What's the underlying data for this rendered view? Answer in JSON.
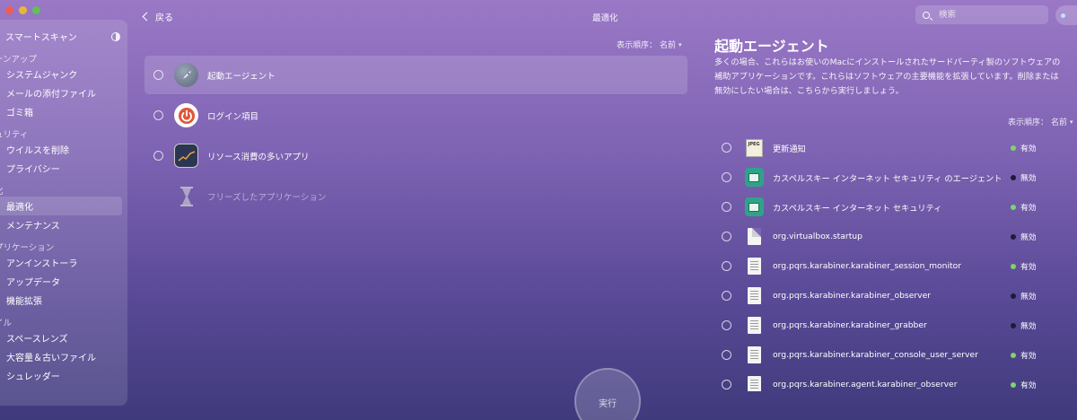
{
  "topbar": {
    "back_label": "戻る",
    "title": "最適化",
    "search_placeholder": "検索"
  },
  "sidebar": {
    "scan_label": "スマートスキャン",
    "sections": [
      {
        "label": "ーンアップ"
      },
      {
        "label": "ュリティ"
      },
      {
        "label": "化"
      },
      {
        "label": "プリケーション"
      },
      {
        "label": "イル"
      }
    ],
    "items": [
      {
        "label": "システムジャンク"
      },
      {
        "label": "メールの添付ファイル"
      },
      {
        "label": "ゴミ箱"
      },
      {
        "label": "ウイルスを削除"
      },
      {
        "label": "プライバシー"
      },
      {
        "label": "最適化"
      },
      {
        "label": "メンテナンス"
      },
      {
        "label": "アンインストーラ"
      },
      {
        "label": "アップデータ"
      },
      {
        "label": "機能拡張"
      },
      {
        "label": "スペースレンズ"
      },
      {
        "label": "大容量＆古いファイル"
      },
      {
        "label": "シュレッダー"
      }
    ]
  },
  "middle": {
    "sort_label": "表示順序：",
    "sort_value": "名前",
    "items": [
      {
        "label": "起動エージェント",
        "icon": "rocket-icon"
      },
      {
        "label": "ログイン項目",
        "icon": "power-icon"
      },
      {
        "label": "リソース消費の多いアプリ",
        "icon": "activity-chart-icon"
      },
      {
        "label": "フリーズしたアプリケーション",
        "icon": "hourglass-icon"
      }
    ]
  },
  "detail": {
    "title": "起動エージェント",
    "description": "多くの場合、これらはお使いのMacにインストールされたサードパーティ製のソフトウェアの補助アプリケーションです。これらはソフトウェアの主要機能を拡張しています。削除または無効にしたい場合は、こちらから実行しましょう。",
    "sort_label": "表示順序：",
    "sort_value": "名前",
    "agents": [
      {
        "name": "更新通知",
        "status": "有効",
        "enabled": true,
        "icon": "jpg-file-icon"
      },
      {
        "name": "カスペルスキー インターネット セキュリティ のエージェント",
        "status": "無効",
        "enabled": false,
        "icon": "kaspersky-icon"
      },
      {
        "name": "カスペルスキー インターネット セキュリティ",
        "status": "有効",
        "enabled": true,
        "icon": "kaspersky-icon"
      },
      {
        "name": "org.virtualbox.startup",
        "status": "無効",
        "enabled": false,
        "icon": "blank-file-icon"
      },
      {
        "name": "org.pqrs.karabiner.karabiner_session_monitor",
        "status": "有効",
        "enabled": true,
        "icon": "text-file-icon"
      },
      {
        "name": "org.pqrs.karabiner.karabiner_observer",
        "status": "無効",
        "enabled": false,
        "icon": "text-file-icon"
      },
      {
        "name": "org.pqrs.karabiner.karabiner_grabber",
        "status": "無効",
        "enabled": false,
        "icon": "text-file-icon"
      },
      {
        "name": "org.pqrs.karabiner.karabiner_console_user_server",
        "status": "有効",
        "enabled": true,
        "icon": "text-file-icon"
      },
      {
        "name": "org.pqrs.karabiner.agent.karabiner_observer",
        "status": "有効",
        "enabled": true,
        "icon": "text-file-icon"
      }
    ]
  },
  "run_label": "実行",
  "colors": {
    "enabled_dot": "#7ed36b",
    "disabled_dot": "#1f1b35"
  }
}
